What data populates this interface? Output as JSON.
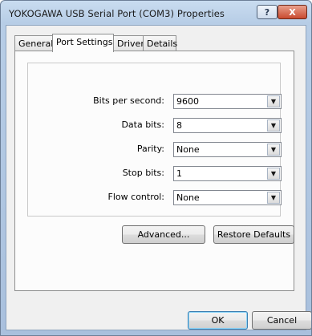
{
  "window": {
    "title": "YOKOGAWA USB Serial Port (COM3) Properties",
    "help_glyph": "?",
    "close_glyph": "X"
  },
  "tabs": [
    {
      "label": "General",
      "active": false
    },
    {
      "label": "Port Settings",
      "active": true
    },
    {
      "label": "Driver",
      "active": false
    },
    {
      "label": "Details",
      "active": false
    }
  ],
  "settings": {
    "bits_per_second": {
      "label": "Bits per second:",
      "value": "9600"
    },
    "data_bits": {
      "label": "Data bits:",
      "value": "8"
    },
    "parity": {
      "label": "Parity:",
      "value": "None"
    },
    "stop_bits": {
      "label": "Stop bits:",
      "value": "1"
    },
    "flow_control": {
      "label": "Flow control:",
      "value": "None"
    }
  },
  "buttons": {
    "advanced": "Advanced...",
    "restore_defaults": "Restore Defaults",
    "ok": "OK",
    "cancel": "Cancel"
  },
  "icons": {
    "dropdown": "chevron-down-icon",
    "help": "help-icon",
    "close": "close-icon"
  },
  "colors": {
    "titlebar": "#b7cde6",
    "close_button": "#c94a2f",
    "dialog_background": "#f0f0f0",
    "default_button_border": "#3c7fb1"
  }
}
